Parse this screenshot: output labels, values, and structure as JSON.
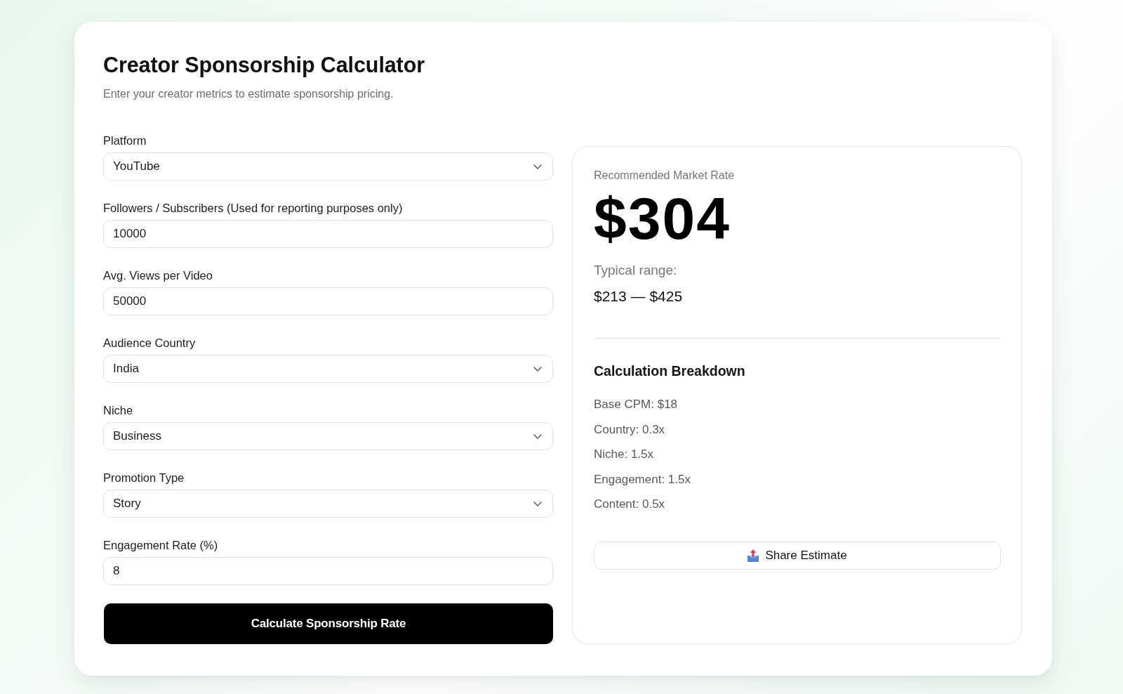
{
  "header": {
    "title": "Creator Sponsorship Calculator",
    "subtitle": "Enter your creator metrics to estimate sponsorship pricing."
  },
  "form": {
    "fields": [
      {
        "kind": "select",
        "label": "Platform",
        "value": "YouTube"
      },
      {
        "kind": "text",
        "label": "Followers / Subscribers (Used for reporting purposes only)",
        "value": "10000"
      },
      {
        "kind": "text",
        "label": "Avg. Views per Video",
        "value": "50000"
      },
      {
        "kind": "select",
        "label": "Audience Country",
        "value": "India"
      },
      {
        "kind": "select",
        "label": "Niche",
        "value": "Business"
      },
      {
        "kind": "select",
        "label": "Promotion Type",
        "value": "Story"
      },
      {
        "kind": "text",
        "label": "Engagement Rate (%)",
        "value": "8"
      }
    ],
    "submit_button": "Calculate Sponsorship Rate"
  },
  "result": {
    "label": "Recommended Market Rate",
    "amount": "$304",
    "range_label": "Typical range:",
    "range": "$213 — $425",
    "breakdown": {
      "title": "Calculation Breakdown",
      "items": [
        "Base CPM: $18",
        "Country: 0.3x",
        "Niche: 1.5x",
        "Engagement: 1.5x",
        "Content: 0.5x"
      ]
    },
    "share_button": "Share Estimate"
  }
}
